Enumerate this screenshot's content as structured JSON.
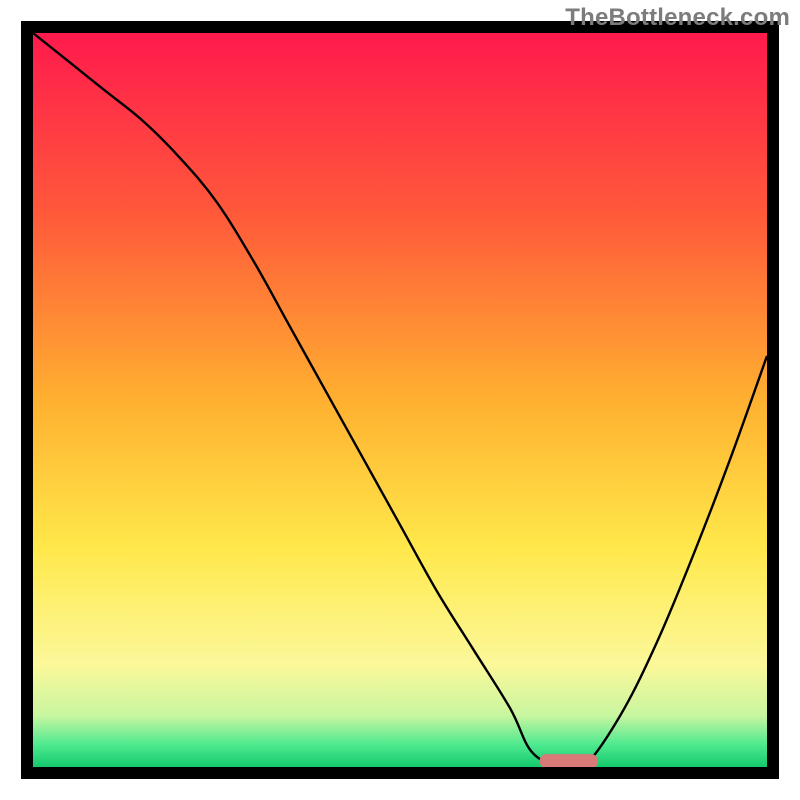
{
  "watermark": "TheBottleneck.com",
  "chart_data": {
    "type": "line",
    "title": "",
    "xlabel": "",
    "ylabel": "",
    "xlim": [
      0,
      100
    ],
    "ylim": [
      0,
      100
    ],
    "background_gradient": {
      "stops": [
        {
          "offset": 0,
          "color": "#ff1a4d"
        },
        {
          "offset": 25,
          "color": "#ff5a3a"
        },
        {
          "offset": 50,
          "color": "#ffb030"
        },
        {
          "offset": 70,
          "color": "#ffe84a"
        },
        {
          "offset": 86,
          "color": "#fcf89a"
        },
        {
          "offset": 93,
          "color": "#c8f6a0"
        },
        {
          "offset": 97,
          "color": "#4de98e"
        },
        {
          "offset": 100,
          "color": "#15c96e"
        }
      ]
    },
    "series": [
      {
        "name": "bottleneck-curve",
        "color": "#000000",
        "x": [
          0,
          5,
          10,
          15,
          20,
          25,
          30,
          35,
          40,
          45,
          50,
          55,
          60,
          65,
          68,
          72,
          75,
          80,
          85,
          90,
          95,
          100
        ],
        "y": [
          100,
          96,
          92,
          88,
          83,
          77,
          69,
          60,
          51,
          42,
          33,
          24,
          16,
          8,
          2,
          0,
          0,
          7,
          17,
          29,
          42,
          56
        ]
      }
    ],
    "marker": {
      "name": "highlight-segment",
      "x_range": [
        69,
        77
      ],
      "y": 0.8,
      "color": "#d87a77"
    },
    "frame_color": "#000000"
  }
}
